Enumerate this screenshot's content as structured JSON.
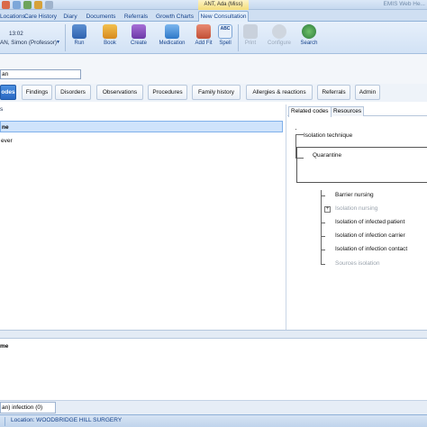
{
  "title_bar": {
    "contextual_title": "ANT, Ada (Miss)",
    "app_title": "EMIS Web He..."
  },
  "ribbon_tabs": [
    "Locations",
    "Care History",
    "Diary",
    "Documents",
    "Referrals",
    "Growth Charts",
    "New Consultation"
  ],
  "patient_info": {
    "time": "13:02",
    "clinician": "AN, Simon (Professor)"
  },
  "ribbon_buttons": {
    "run": "Run",
    "book": "Book",
    "create": "Create",
    "medication": "Medication",
    "add_fit": "Add Fit",
    "spell": "Spell",
    "print": "Print",
    "configure": "Configure",
    "search": "Search"
  },
  "search": {
    "value": "an"
  },
  "categories": {
    "codes": "odes",
    "findings": "Findings",
    "disorders": "Disorders",
    "observations": "Observations",
    "procedures": "Procedures",
    "family_history": "Family history",
    "allergies": "Allergies & reactions",
    "referrals": "Referrals",
    "admin": "Admin"
  },
  "left_pane": {
    "header": "s",
    "results": [
      "ne",
      "ever"
    ]
  },
  "right_pane": {
    "tabs": {
      "related": "Related codes",
      "resources": "Resources"
    },
    "tree": {
      "parent": "Isolation technique",
      "selected": "Quarantine",
      "children": [
        "Barrier nursing",
        "Isolation nursing",
        "Isolation of infected patient",
        "Isolation of infection carrier",
        "Isolation of infection contact",
        "Sources isolation"
      ]
    }
  },
  "bottom": {
    "label": "me",
    "doc_tab": "an) infection (0)"
  },
  "status_bar": {
    "location": "Location:  WOODBRIDGE HILL SURGERY"
  }
}
